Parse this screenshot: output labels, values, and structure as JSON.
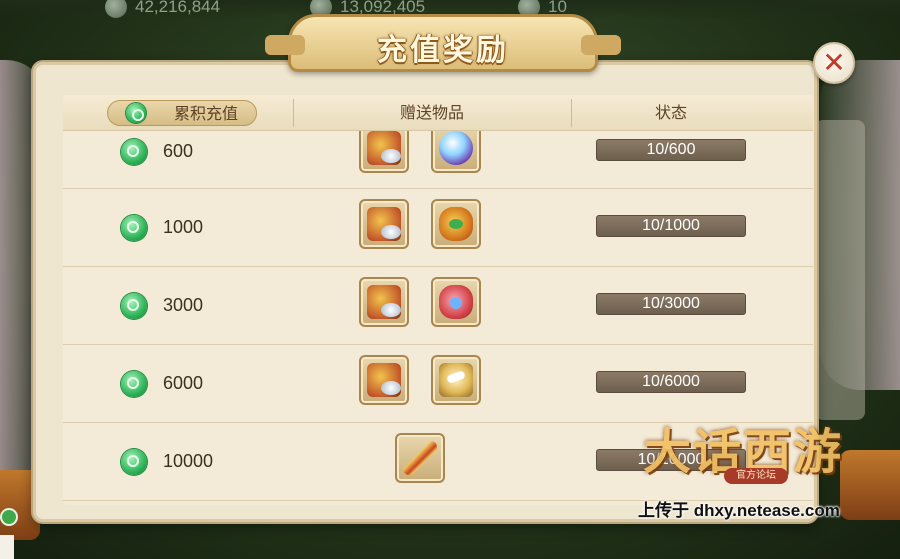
{
  "hud": {
    "values": [
      "42,216,844",
      "13,092,405",
      "10"
    ]
  },
  "dialog": {
    "title": "充值奖励",
    "close_icon": "close-icon"
  },
  "table": {
    "headers": [
      "累积充值",
      "赠送物品",
      "状态"
    ],
    "rows": [
      {
        "amount": "600",
        "items": [
          "silver-bag-icon",
          "crystal-orb-icon"
        ],
        "status": "10/600"
      },
      {
        "amount": "1000",
        "items": [
          "silver-bag-icon",
          "lucky-bag-icon"
        ],
        "status": "10/1000"
      },
      {
        "amount": "3000",
        "items": [
          "silver-bag-icon",
          "red-gift-bag-icon"
        ],
        "status": "10/3000"
      },
      {
        "amount": "6000",
        "items": [
          "silver-bag-icon",
          "golden-dragon-icon"
        ],
        "status": "10/6000"
      },
      {
        "amount": "10000",
        "items": [
          "golden-spear-icon"
        ],
        "status": "10/10000"
      }
    ]
  },
  "watermark": {
    "logo": "大话西游",
    "logo_sub": "官方论坛",
    "upload_text": "上传于 dhxy.netease.com"
  },
  "colors": {
    "panel_bg": "#efe6d0",
    "status_bar": "#7d6d5a",
    "close_x": "#c0392b",
    "jade_green": "#2fb458"
  }
}
